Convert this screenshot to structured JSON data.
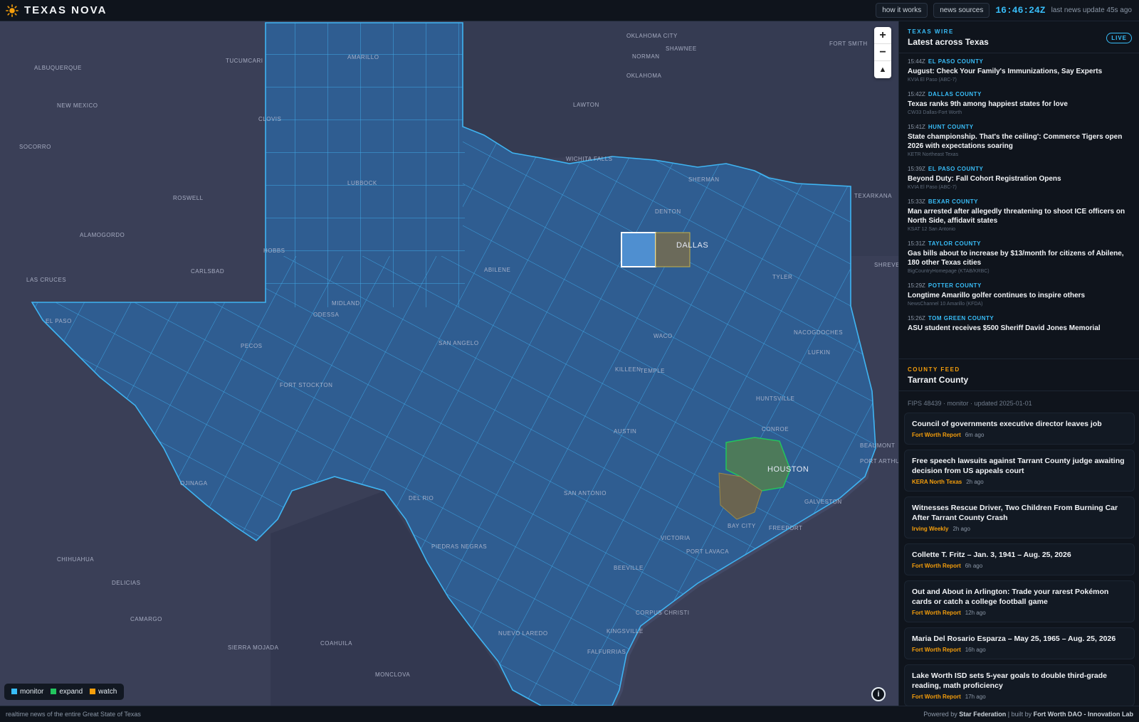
{
  "app": {
    "name": "TEXAS NOVA",
    "logo_icon": "sun-icon"
  },
  "topbar": {
    "how_it_works": "how it works",
    "news_sources": "news sources",
    "clock": "16:46:24Z",
    "last_update": "last news update 45s ago"
  },
  "map": {
    "cities": {
      "oklahoma_city": "OKLAHOMA CITY",
      "norman": "NORMAN",
      "shawnee": "SHAWNEE",
      "oklahoma": "OKLAHOMA",
      "fort_smith": "FORT SMITH",
      "amarillo": "AMARILLO",
      "tucumcari": "TUCUMCARI",
      "albuquerque": "ALBUQUERQUE",
      "new_mexico": "NEW MEXICO",
      "clovis": "CLOVIS",
      "lawton": "LAWTON",
      "socorro": "SOCORRO",
      "wichita_falls": "WICHITA FALLS",
      "sherman": "SHERMAN",
      "texarkana": "TEXARKANA",
      "lubbock": "LUBBOCK",
      "roswell": "ROSWELL",
      "denton": "DENTON",
      "dallas": "DALLAS",
      "alamogordo": "ALAMOGORDO",
      "hobbs": "HOBBS",
      "abilene": "ABILENE",
      "tyler": "TYLER",
      "shreveport": "SHREVEPO",
      "carlsbad": "CARLSBAD",
      "las_cruces": "LAS CRUCES",
      "midland": "MIDLAND",
      "odessa": "ODESSA",
      "el_paso": "EL PASO",
      "waco": "WACO",
      "nacogdoches": "NACOGDOCHES",
      "pecos": "PECOS",
      "san_angelo": "SAN ANGELO",
      "lufkin": "LUFKIN",
      "killeen": "KILLEEN",
      "temple": "TEMPLE",
      "fort_stockton": "FORT STOCKTON",
      "huntsville": "HUNTSVILLE",
      "conroe": "CONROE",
      "austin": "AUSTIN",
      "beaumont": "BEAUMONT",
      "port_arthur": "PORT ARTHUR",
      "houston": "HOUSTON",
      "ojinaga": "OJINAGA",
      "san_antonio": "SAN ANTONIO",
      "del_rio": "DEL RIO",
      "galveston": "GALVESTON",
      "bay_city": "BAY CITY",
      "freeport": "FREEPORT",
      "victoria": "VICTORIA",
      "port_lavaca": "PORT LAVACA",
      "piedras_negras": "PIEDRAS NEGRAS",
      "chihuahua": "CHIHUAHUA",
      "beeville": "BEEVILLE",
      "delicias": "DELICIAS",
      "corpus_christi": "CORPUS CHRISTI",
      "camargo": "CAMARGO",
      "kingsville": "KINGSVILLE",
      "nuevo_laredo": "NUEVO LAREDO",
      "sierra_mojada": "SIERRA MOJADA",
      "coahuila": "COAHUILA",
      "falfurrias": "FALFURRIAS",
      "monclova": "MONCLOVA"
    },
    "colors": {
      "monitor": "#38bdf8",
      "expand": "#22c55e",
      "watch": "#f59e0b"
    },
    "legend": {
      "monitor": "monitor",
      "expand": "expand",
      "watch": "watch"
    },
    "zoom_in": "+",
    "zoom_out": "−",
    "compass": "▲"
  },
  "wire": {
    "kicker": "TEXAS WIRE",
    "title": "Latest across Texas",
    "live": "LIVE",
    "items": [
      {
        "time": "15:44Z",
        "county": "EL PASO COUNTY",
        "title": "August: Check Your Family's Immunizations, Say Experts",
        "source": "KVIA El Paso (ABC-7)"
      },
      {
        "time": "15:42Z",
        "county": "DALLAS COUNTY",
        "title": "Texas ranks 9th among happiest states for love",
        "source": "CW33 Dallas-Fort Worth"
      },
      {
        "time": "15:41Z",
        "county": "HUNT COUNTY",
        "title": "State championship. That's the ceiling': Commerce Tigers open 2026 with expectations soaring",
        "source": "KETR Northeast Texas"
      },
      {
        "time": "15:39Z",
        "county": "EL PASO COUNTY",
        "title": "Beyond Duty: Fall Cohort Registration Opens",
        "source": "KVIA El Paso (ABC-7)"
      },
      {
        "time": "15:33Z",
        "county": "BEXAR COUNTY",
        "title": "Man arrested after allegedly threatening to shoot ICE officers on North Side, affidavit states",
        "source": "KSAT 12 San Antonio"
      },
      {
        "time": "15:31Z",
        "county": "TAYLOR COUNTY",
        "title": "Gas bills about to increase by $13/month for citizens of Abilene, 180 other Texas cities",
        "source": "BigCountryHomepage (KTAB/KRBC)"
      },
      {
        "time": "15:29Z",
        "county": "POTTER COUNTY",
        "title": "Longtime Amarillo golfer continues to inspire others",
        "source": "NewsChannel 10 Amarillo (KFDA)"
      },
      {
        "time": "15:26Z",
        "county": "TOM GREEN COUNTY",
        "title": "ASU student receives $500 Sheriff David Jones Memorial",
        "source": ""
      }
    ]
  },
  "county_feed": {
    "kicker": "COUNTY FEED",
    "title": "Tarrant County",
    "fips": "FIPS 48439 · monitor · updated 2025-01-01",
    "items": [
      {
        "title": "Council of governments executive director leaves job",
        "source": "Fort Worth Report",
        "age": "6m ago"
      },
      {
        "title": "Free speech lawsuits against Tarrant County judge awaiting decision from US appeals court",
        "source": "KERA North Texas",
        "age": "2h ago"
      },
      {
        "title": "Witnesses Rescue Driver, Two Children From Burning Car After Tarrant County Crash",
        "source": "Irving Weekly",
        "age": "2h ago"
      },
      {
        "title": "Collette T. Fritz – Jan. 3, 1941 – Aug. 25, 2026",
        "source": "Fort Worth Report",
        "age": "6h ago"
      },
      {
        "title": "Out and About in Arlington: Trade your rarest Pokémon cards or catch a college football game",
        "source": "Fort Worth Report",
        "age": "12h ago"
      },
      {
        "title": "Maria Del Rosario Esparza – May 25, 1965 – Aug. 25, 2026",
        "source": "Fort Worth Report",
        "age": "16h ago"
      },
      {
        "title": "Lake Worth ISD sets 5-year goals to double third-grade reading, math proficiency",
        "source": "Fort Worth Report",
        "age": "17h ago"
      }
    ]
  },
  "footer": {
    "left": "realtime news of the entire Great State of Texas",
    "powered_prefix": "Powered by",
    "powered_org": "Star Federation",
    "built_prefix": "| built by",
    "built_org": "Fort Worth DAO - Innovation Lab"
  }
}
